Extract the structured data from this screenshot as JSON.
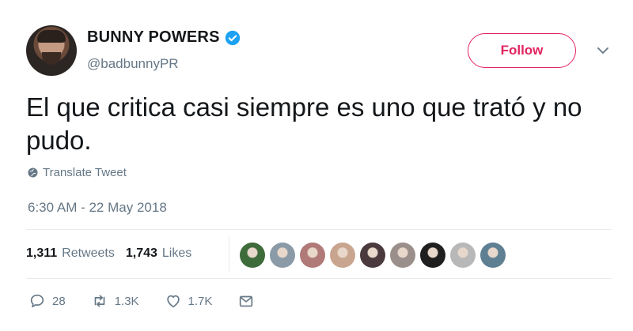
{
  "author": {
    "display_name": "BUNNY POWERS",
    "handle": "@badbunnyPR",
    "avatar_icon": "avatar",
    "verified_icon": "verified-badge-icon"
  },
  "follow_label": "Follow",
  "tweet": {
    "text": "El que critica casi siempre es uno que trató y no pudo.",
    "translate_label": "Translate Tweet",
    "timestamp": "6:30 AM - 22 May 2018"
  },
  "stats": {
    "retweets_count": "1,311",
    "retweets_label": "Retweets",
    "likes_count": "1,743",
    "likes_label": "Likes"
  },
  "liker_avatars": [
    "#3e6b3a",
    "#8a9aa6",
    "#b07a78",
    "#c9a58f",
    "#4a3a3e",
    "#9a8f8a",
    "#1f1f1f",
    "#b8b8b8",
    "#5f7f93"
  ],
  "actions": {
    "reply_count": "28",
    "retweet_count": "1.3K",
    "like_count": "1.7K"
  },
  "colors": {
    "accent_pink": "#e0245e",
    "verified_blue": "#1da1f2",
    "secondary_text": "#657786"
  }
}
